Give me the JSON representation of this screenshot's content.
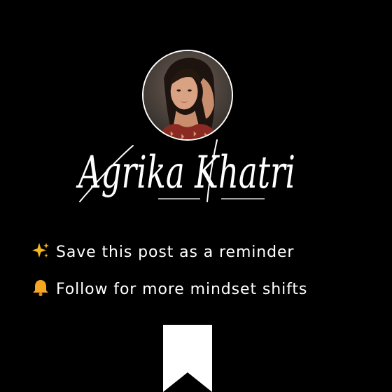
{
  "profile": {
    "name": "Agrika Khatri",
    "avatar_icon": "woman-portrait-photo"
  },
  "cta": [
    {
      "icon": "sparkles-icon",
      "text": "Save this post as a reminder"
    },
    {
      "icon": "bell-icon",
      "text": "Follow for more mindset shifts"
    }
  ],
  "bookmark_icon": "bookmark-icon",
  "colors": {
    "background": "#000000",
    "text": "#ffffff",
    "accent_gold": "#f5b71e",
    "bell_orange": "#f5a623"
  }
}
